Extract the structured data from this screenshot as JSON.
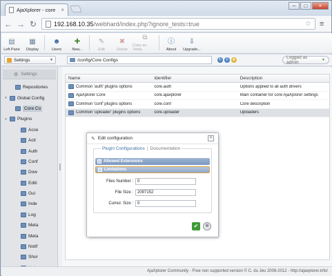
{
  "browser": {
    "tab_title": "AjaXplorer - core",
    "tab_close": "×",
    "url_host": "192.168.10.35",
    "url_path": "/webhard/index.php?ignore_tests=true",
    "win_min": "–",
    "win_max": "□",
    "win_close": "×"
  },
  "toolbar": {
    "buttons": [
      {
        "label": "Left Pane",
        "icon": "layout-icon"
      },
      {
        "label": "Display",
        "icon": "display-icon"
      },
      {
        "label": "Users",
        "icon": "users-icon"
      },
      {
        "label": "New...",
        "icon": "new-icon"
      },
      {
        "label": "Edit",
        "icon": "edit-icon"
      },
      {
        "label": "Delete",
        "icon": "delete-icon"
      },
      {
        "label": "Copy as Temp.",
        "icon": "copy-icon"
      },
      {
        "label": "About",
        "icon": "info-icon"
      },
      {
        "label": "Upgrade...",
        "icon": "upgrade-icon"
      }
    ]
  },
  "location": {
    "workspace": "Settings",
    "path": "/config/Core Configs",
    "logged": "Logged as admin"
  },
  "left_panel": {
    "header": "Settings",
    "tree": [
      {
        "label": "Repositories",
        "indent": 1
      },
      {
        "label": "Global Config",
        "indent": 0
      },
      {
        "label": "Core Co",
        "indent": 1,
        "selected": true
      },
      {
        "label": "Plugins",
        "indent": 0
      },
      {
        "label": "Acce",
        "indent": 2
      },
      {
        "label": "Acti",
        "indent": 2
      },
      {
        "label": "Auth",
        "indent": 2
      },
      {
        "label": "Conf",
        "indent": 2
      },
      {
        "label": "Dow",
        "indent": 2
      },
      {
        "label": "Editi",
        "indent": 2
      },
      {
        "label": "Gui",
        "indent": 2
      },
      {
        "label": "Inde",
        "indent": 2
      },
      {
        "label": "Log",
        "indent": 2
      },
      {
        "label": "Meta",
        "indent": 2
      },
      {
        "label": "Meta",
        "indent": 2
      },
      {
        "label": "Notif",
        "indent": 2
      },
      {
        "label": "Shor",
        "indent": 2
      },
      {
        "label": "Uplo",
        "indent": 2
      }
    ]
  },
  "file_list": {
    "columns": [
      "Name",
      "Identifier",
      "Description"
    ],
    "rows": [
      {
        "name": "Common 'auth' plugins options",
        "id": "core.auth",
        "desc": "Options applied to all auth drivers"
      },
      {
        "name": "AjaXplorer Core",
        "id": "core.ajaxplorer",
        "desc": "Main container for core AjaXplorer settings"
      },
      {
        "name": "Common 'conf' plugins options",
        "id": "core.conf",
        "desc": "Core description"
      },
      {
        "name": "Common 'uploader' plugins options",
        "id": "core.uploader",
        "desc": "Uploaders",
        "selected": true
      }
    ]
  },
  "modal": {
    "title": "Edit configuration",
    "close": "×",
    "tab_active": "Plugin Configurations",
    "tab_sep": "|",
    "tab_inactive": "Documentation",
    "acc1": "Allowed Extensions",
    "acc2": "Limitations",
    "acc1_sign": "+",
    "acc2_sign": "–",
    "fields": [
      {
        "label": "Files Number :",
        "value": "0"
      },
      {
        "label": "File Size :",
        "value": "2097152"
      },
      {
        "label": "Cumul. Size :",
        "value": "0"
      }
    ],
    "ok": "✔",
    "cancel": "⊗"
  },
  "footer": "AjaXplorer Community - Free non supported version © C. du Jeu 2008-2012 - http://ajaxplorer.info/"
}
